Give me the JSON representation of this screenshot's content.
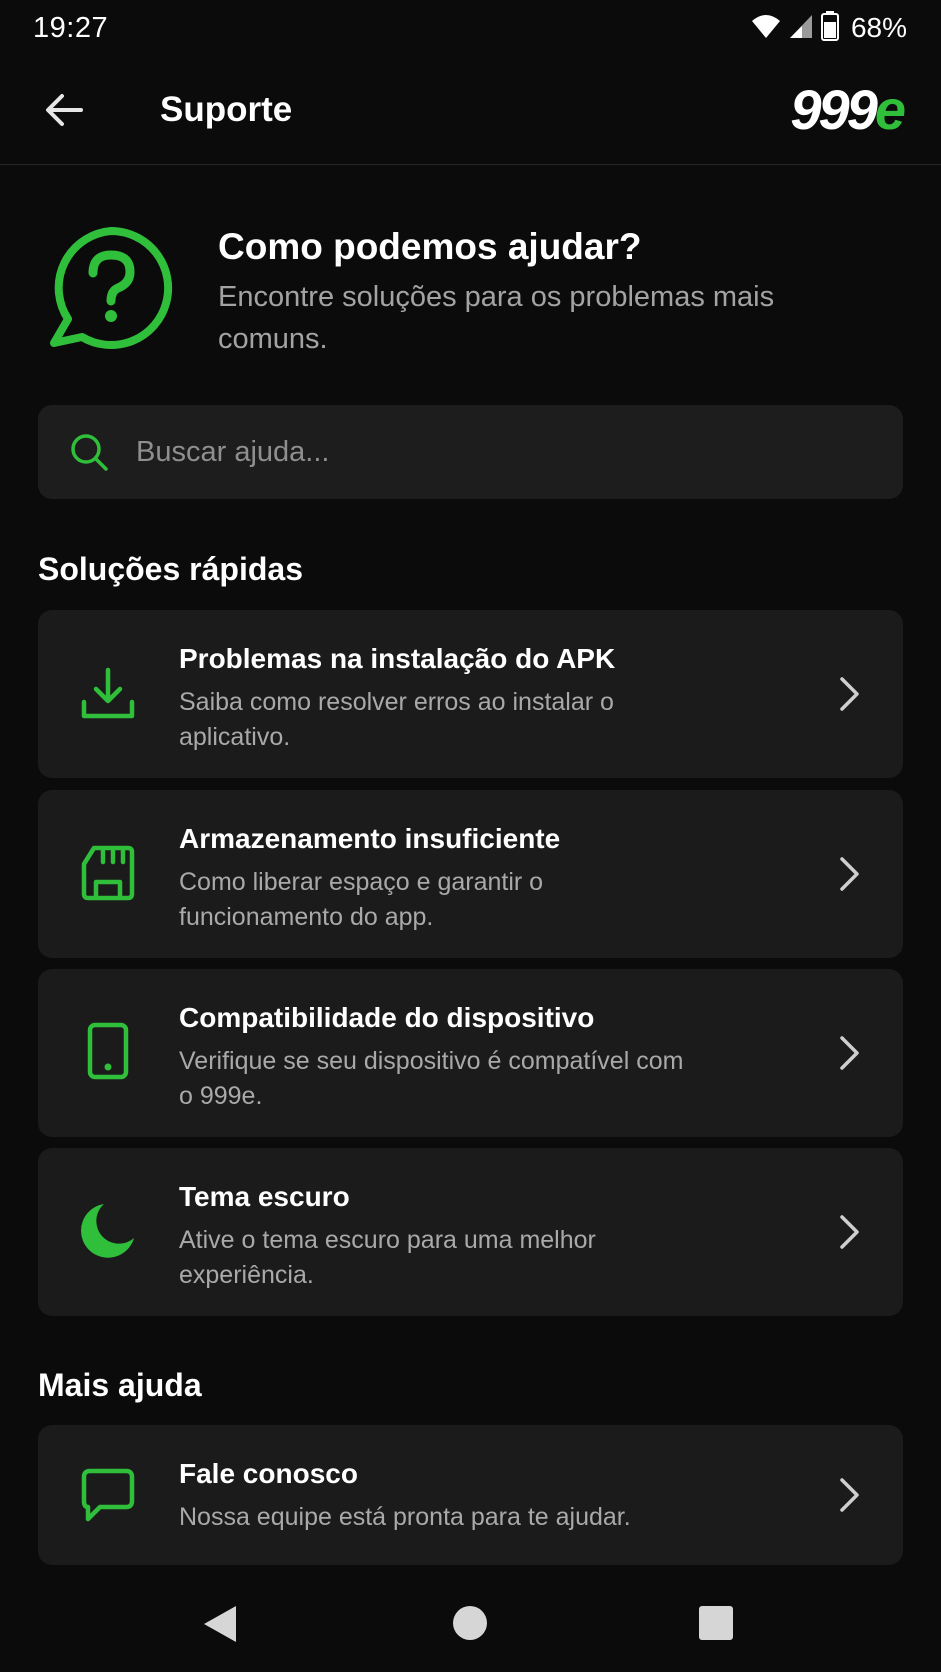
{
  "status_bar": {
    "time": "19:27",
    "battery_percent": "68%",
    "icons": [
      "wifi-icon",
      "cell-signal-icon",
      "battery-icon"
    ]
  },
  "app_bar": {
    "title": "Suporte",
    "back_icon": "arrow-left-icon",
    "logo_digits": "999",
    "logo_accent": "e"
  },
  "hero": {
    "title": "Como podemos ajudar?",
    "subtitle": "Encontre soluções para os problemas mais comuns.",
    "icon": "help-chat-icon"
  },
  "search": {
    "placeholder": "Buscar ajuda...",
    "value": ""
  },
  "quick_solutions": {
    "heading": "Soluções rápidas",
    "items": [
      {
        "title": "Problemas na instalação do APK",
        "description": "Saiba como resolver erros ao instalar o aplicativo.",
        "icon": "download-icon"
      },
      {
        "title": "Armazenamento insuficiente",
        "description": "Como liberar espaço e garantir o funcionamento do app.",
        "icon": "sd-card-icon"
      },
      {
        "title": "Compatibilidade do dispositivo",
        "description": "Verifique se seu dispositivo é compatível com o 999e.",
        "icon": "phone-device-icon"
      },
      {
        "title": "Tema escuro",
        "description": "Ative o tema escuro para uma melhor experiência.",
        "icon": "moon-icon"
      }
    ]
  },
  "more_help": {
    "heading": "Mais ajuda",
    "items": [
      {
        "title": "Fale conosco",
        "description": "Nossa equipe está pronta para te ajudar.",
        "icon": "chat-bubble-icon"
      }
    ]
  },
  "colors": {
    "background": "#0b0b0b",
    "card": "#1b1b1b",
    "accent": "#2fbf3a",
    "text_secondary": "#a9a9a9"
  }
}
